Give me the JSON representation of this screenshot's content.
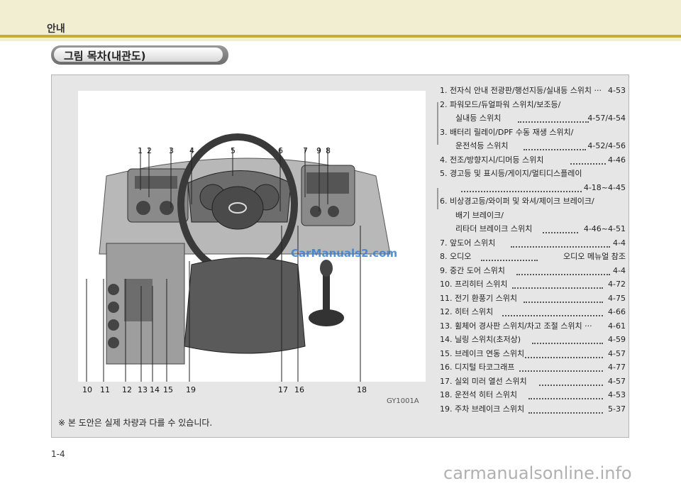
{
  "header": {
    "section": "안내"
  },
  "heading": "그림 목차(내관도)",
  "figure": {
    "code": "GY1001A",
    "watermark": "CarManuals2.com",
    "top_numbers": [
      "1",
      "2",
      "3",
      "4",
      "5",
      "6",
      "7",
      "9",
      "8"
    ],
    "bottom_numbers": [
      "10",
      "11",
      "12",
      "13",
      "14",
      "15",
      "19",
      "17",
      "16",
      "18"
    ]
  },
  "note": "※ 본 도안은 실제 차량과 다를 수 있습니다.",
  "toc": [
    {
      "text": "1. 전자식 안내 전광판/행선지등/실내등 스위치 ···",
      "page": "4-53"
    },
    {
      "text": "2. 파워모드/듀얼파워 스위치/보조등/",
      "page": ""
    },
    {
      "text": "실내등 스위치",
      "page": "4-57/4-54",
      "indent": true
    },
    {
      "text": "3. 배터리 릴레이/DPF 수동 재생 스위치/",
      "page": ""
    },
    {
      "text": "운전석등 스위치",
      "page": "4-52/4-56",
      "indent": true
    },
    {
      "text": "4. 전조/방향지시/디머등 스위치",
      "page": "4-46"
    },
    {
      "text": "5. 경고등 및 표시등/게이지/멀티디스플레이",
      "page": ""
    },
    {
      "text": "",
      "page": "4-18~4-45",
      "indent": true
    },
    {
      "text": "6. 비상경고등/와이퍼 및 와셔/제이크 브레이크/",
      "page": ""
    },
    {
      "text": "배기 브레이크/",
      "page": "",
      "indent": true
    },
    {
      "text": "리타더 브레이크 스위치",
      "page": "4-46~4-51",
      "indent": true
    },
    {
      "text": "7. 앞도어 스위치",
      "page": "4-4"
    },
    {
      "text": "8. 오디오",
      "page": "오디오 메뉴얼 참조"
    },
    {
      "text": "9. 중간 도어 스위치",
      "page": "4-4"
    },
    {
      "text": "10. 프리히터 스위치",
      "page": "4-72"
    },
    {
      "text": "11. 전기 환풍기 스위치",
      "page": "4-75"
    },
    {
      "text": "12. 히터 스위치",
      "page": "4-66"
    },
    {
      "text": "13. 휠체어 경사판 스위치/차고 조절 스위치 ···",
      "page": "4-61"
    },
    {
      "text": "14. 닐링 스위치(초저상)",
      "page": "4-59"
    },
    {
      "text": "15. 브레이크 연동 스위치",
      "page": "4-57"
    },
    {
      "text": "16. 디지털 타코그래프",
      "page": "4-77"
    },
    {
      "text": "17. 실외 미러 열선 스위치",
      "page": "4-57"
    },
    {
      "text": "18. 운전석 히터 스위치",
      "page": "4-53"
    },
    {
      "text": "19. 주차 브레이크 스위치",
      "page": "5-37"
    }
  ],
  "page_number": "1-4",
  "footer_watermark": "carmanualsonline.info"
}
